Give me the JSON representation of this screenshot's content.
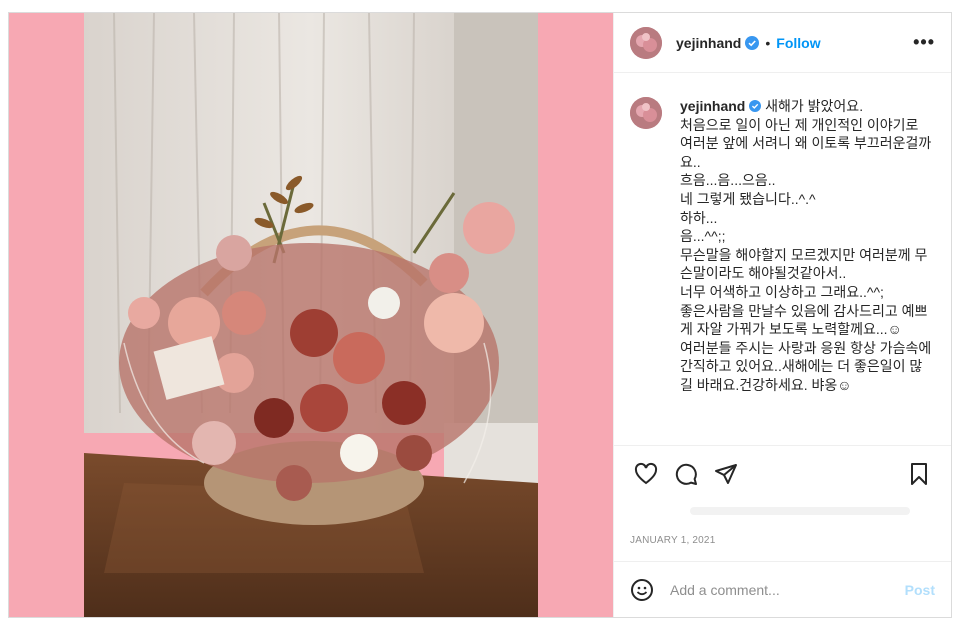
{
  "colors": {
    "media_background": "#f7a8b3",
    "accent": "#0095f6",
    "verified_badge": "#3897f0",
    "muted_text": "#8e8e8e",
    "post_disabled": "#b2dffc"
  },
  "header": {
    "username": "yejinhand",
    "separator": "•",
    "follow_label": "Follow",
    "more_label": "•••",
    "icons": [
      "avatar",
      "verified-badge-icon",
      "more-options-icon"
    ]
  },
  "caption": {
    "username": "yejinhand",
    "text": "새해가 밝았어요.\n처음으로 일이 아닌 제 개인적인 이야기로 여러분 앞에 서려니 왜 이토록 부끄러운걸까요..\n흐음...음...으음..\n네 그렇게 됐습니다..^.^\n하하...\n음...^^;;\n무슨말을 해야할지 모르겠지만 여러분께 무슨말이라도 해야될것같아서..\n너무 어색하고 이상하고 그래요..^^;\n좋은사람을 만날수 있음에 감사드리고 예쁘게 자알 가꿔가 보도록 노력할께요...☺\n여러분들 주시는 사랑과 응원 항상 가슴속에 간직하고 있어요..새해에는 더 좋은일이 많길 바래요.건강하세요. 뱌옹☺"
  },
  "actions": {
    "icons": [
      "heart-icon",
      "comment-icon",
      "share-icon",
      "bookmark-icon"
    ]
  },
  "date": "JANUARY 1, 2021",
  "add_comment": {
    "placeholder": "Add a comment...",
    "post_label": "Post",
    "icon": "emoji-icon"
  }
}
